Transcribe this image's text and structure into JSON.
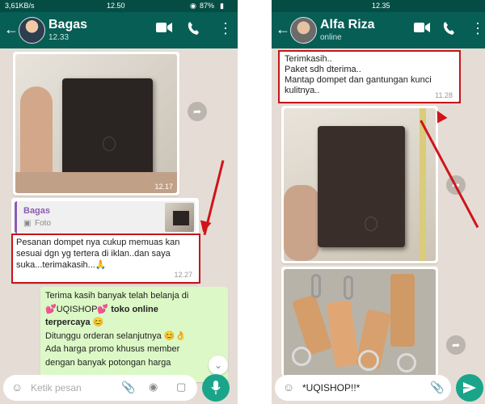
{
  "left": {
    "status": {
      "speed": "3,61KB/s",
      "clock": "12.50",
      "battery": "87%"
    },
    "contact": {
      "name": "Bagas",
      "subtitle": "12.33"
    },
    "photo1_time": "12.17",
    "reply": {
      "quoted_name": "Bagas",
      "quoted_type": "Foto",
      "text": "Pesanan dompet nya cukup memuas kan sesuai dgn yg tertera di iklan..dan saya suka...terimakasih...🙏",
      "time": "12.27"
    },
    "outgoing": {
      "line1": "Terima kasih banyak telah belanja di",
      "line2_pre": "💕UQISHOP💕",
      "line2_bold": "toko online",
      "line3": "terpercaya 😊",
      "line4": "Ditunggu orderan selanjutnya 😊👌",
      "line5": "Ada harga promo khusus member",
      "line6": "dengan banyak potongan harga"
    },
    "input_placeholder": "Ketik pesan"
  },
  "right": {
    "status": {
      "clock": "12.35"
    },
    "contact": {
      "name": "Alfa Riza",
      "subtitle": "online"
    },
    "message": {
      "line1": "Terimkasih..",
      "line2": "Paket sdh dterima..",
      "line3": "Mantap dompet dan gantungan kunci kulitnya..",
      "time": "11.28"
    },
    "input_text": "*UQISHOP!!*"
  },
  "colors": {
    "header": "#075e54",
    "status": "#054d44",
    "chat_bg": "#e5ddd5",
    "outgoing": "#dcf8c6",
    "accent": "#1aa58a",
    "annotation": "#c4161c"
  }
}
